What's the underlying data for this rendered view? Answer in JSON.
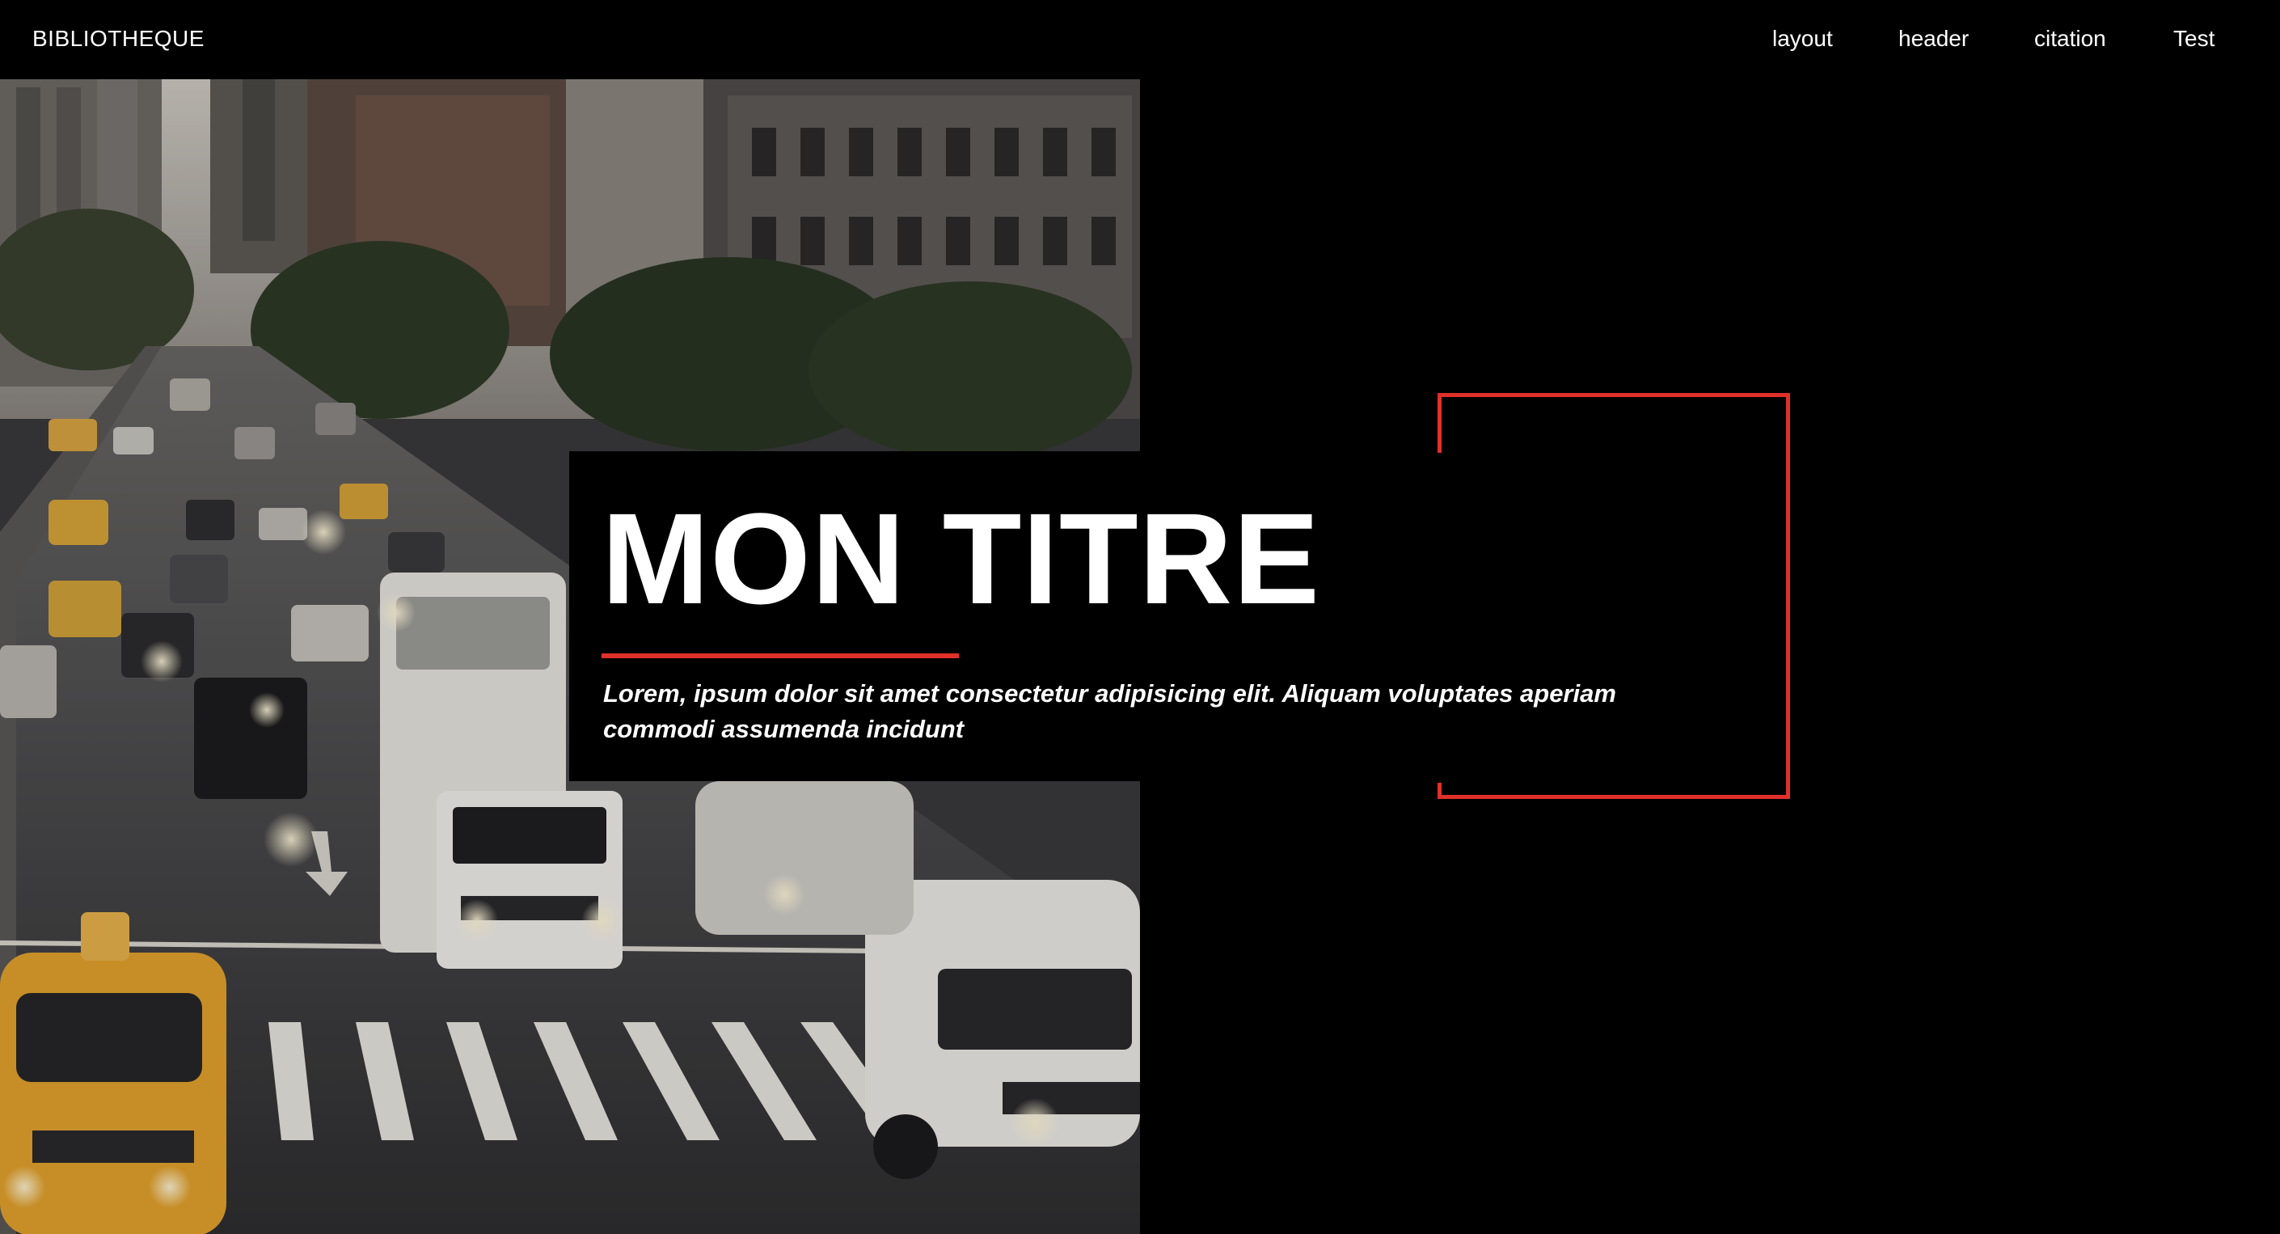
{
  "nav": {
    "brand": "BIBLIOTHEQUE",
    "links": [
      {
        "label": "layout"
      },
      {
        "label": "header"
      },
      {
        "label": "citation"
      },
      {
        "label": "Test"
      }
    ]
  },
  "hero": {
    "title": "MON TITRE",
    "lead": "Lorem, ipsum dolor sit amet consectetur adipisicing elit. Aliquam voluptates aperiam commodi assumenda incidunt",
    "image": "city street traffic photo"
  },
  "colors": {
    "background": "#000000",
    "accent": "#e0302a",
    "text": "#ffffff"
  }
}
